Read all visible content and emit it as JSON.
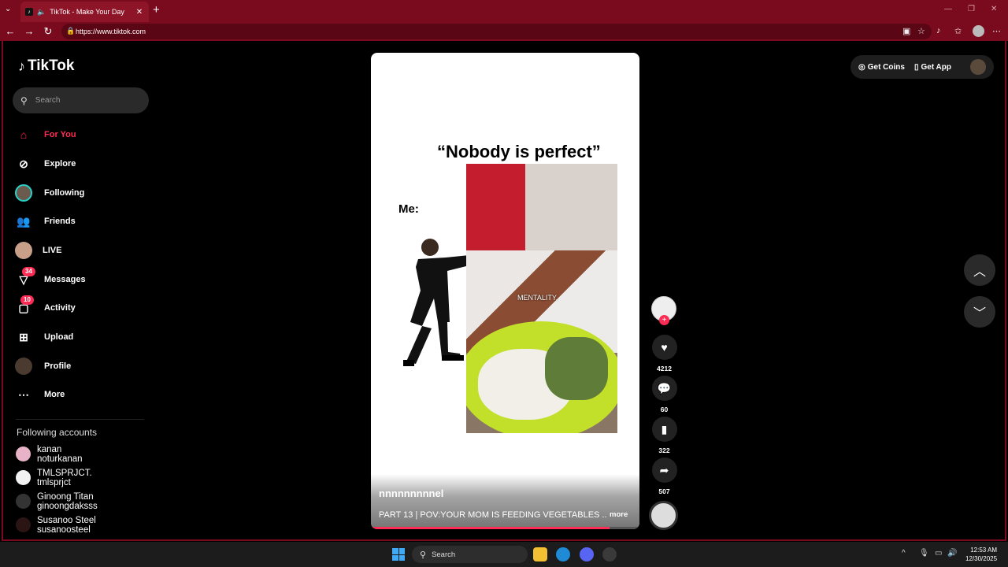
{
  "browser": {
    "tab_title": "TikTok - Make Your Day",
    "url": "https://www.tiktok.com",
    "icons": [
      "tab-menu-icon",
      "speaker-icon",
      "close-icon",
      "new-tab-icon",
      "back-icon",
      "forward-icon",
      "refresh-icon",
      "lock-icon",
      "reader-icon",
      "favorite-icon",
      "extensions-icon",
      "collections-icon",
      "profile-icon",
      "more-icon"
    ]
  },
  "sidebar": {
    "logo": "TikTok",
    "search_placeholder": "Search",
    "nav": [
      {
        "label": "For You",
        "icon": "home-icon",
        "active": true
      },
      {
        "label": "Explore",
        "icon": "compass-icon"
      },
      {
        "label": "Following",
        "icon": "avatar"
      },
      {
        "label": "Friends",
        "icon": "friends-icon"
      },
      {
        "label": "LIVE",
        "icon": "avatar"
      },
      {
        "label": "Messages",
        "icon": "messages-icon",
        "badge": "34"
      },
      {
        "label": "Activity",
        "icon": "activity-icon",
        "badge": "10"
      },
      {
        "label": "Upload",
        "icon": "upload-icon"
      },
      {
        "label": "Profile",
        "icon": "avatar"
      },
      {
        "label": "More",
        "icon": "more-icon"
      }
    ],
    "following_title": "Following accounts",
    "accounts": [
      {
        "name": "kanan",
        "username": "noturkanan"
      },
      {
        "name": "TMLSPRJCT.",
        "username": "tmlsprjct"
      },
      {
        "name": "Ginoong Titan",
        "username": "ginoongdaksss"
      },
      {
        "name": "Susanoo Steel",
        "username": "susanoosteel"
      }
    ]
  },
  "video": {
    "quote": "“Nobody is perfect”",
    "me_label": "Me:",
    "overlay_text": "MENTALITY.",
    "username": "nnnnnnnnnel",
    "caption": "PART 13 | POV:YOUR MOM IS FEEDING VEGETABLES ...",
    "more_label": "more",
    "progress": 0.89
  },
  "actions": {
    "likes": "4212",
    "comments": "60",
    "saves": "322",
    "shares": "507"
  },
  "topbar": {
    "get_coins": "Get Coins",
    "get_app": "Get App"
  },
  "taskbar": {
    "search": "Search",
    "time": "12:53 AM",
    "date": "12/30/2025"
  },
  "colors": {
    "accent": "#fe2c55",
    "browser_frame": "#7a0a1e"
  }
}
